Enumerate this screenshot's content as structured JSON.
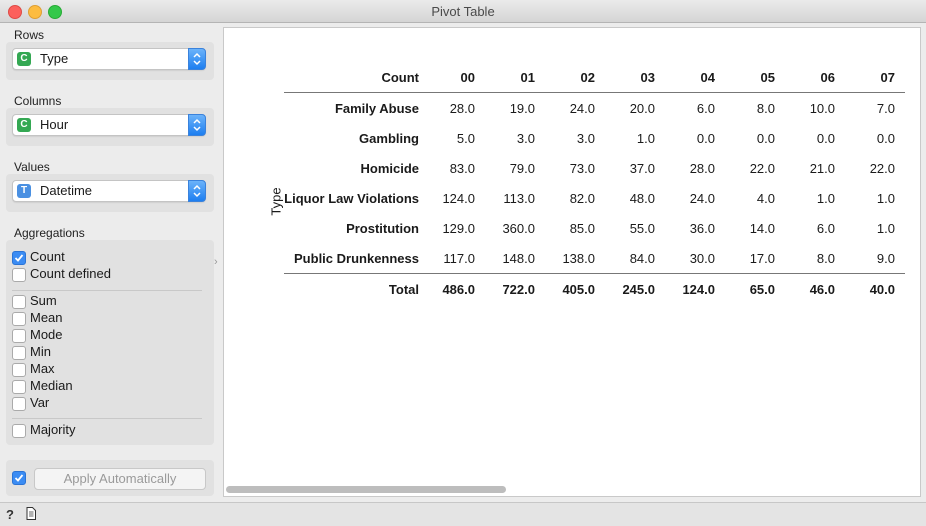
{
  "window": {
    "title": "Pivot Table"
  },
  "rows": {
    "label": "Rows",
    "value": "Type",
    "type_icon": "C"
  },
  "columns": {
    "label": "Columns",
    "value": "Hour",
    "type_icon": "C"
  },
  "values": {
    "label": "Values",
    "value": "Datetime",
    "type_icon": "T"
  },
  "aggregations": {
    "label": "Aggregations",
    "items": [
      {
        "label": "Count",
        "checked": true
      },
      {
        "label": "Count defined",
        "checked": false
      },
      {
        "label": "Sum",
        "checked": false
      },
      {
        "label": "Mean",
        "checked": false
      },
      {
        "label": "Mode",
        "checked": false
      },
      {
        "label": "Min",
        "checked": false
      },
      {
        "label": "Max",
        "checked": false
      },
      {
        "label": "Median",
        "checked": false
      },
      {
        "label": "Var",
        "checked": false
      },
      {
        "label": "Majority",
        "checked": false
      }
    ]
  },
  "apply": {
    "label": "Apply Automatically",
    "checked": true
  },
  "pivot": {
    "row_variable": "Type",
    "corner": "Count",
    "headers": [
      "00",
      "01",
      "02",
      "03",
      "04",
      "05",
      "06",
      "07"
    ],
    "rows": [
      {
        "label": "Family Abuse",
        "values": [
          "28.0",
          "19.0",
          "24.0",
          "20.0",
          "6.0",
          "8.0",
          "10.0",
          "7.0"
        ]
      },
      {
        "label": "Gambling",
        "values": [
          "5.0",
          "3.0",
          "3.0",
          "1.0",
          "0.0",
          "0.0",
          "0.0",
          "0.0"
        ]
      },
      {
        "label": "Homicide",
        "values": [
          "83.0",
          "79.0",
          "73.0",
          "37.0",
          "28.0",
          "22.0",
          "21.0",
          "22.0"
        ]
      },
      {
        "label": "Liquor Law Violations",
        "values": [
          "124.0",
          "113.0",
          "82.0",
          "48.0",
          "24.0",
          "4.0",
          "1.0",
          "1.0"
        ]
      },
      {
        "label": "Prostitution",
        "values": [
          "129.0",
          "360.0",
          "85.0",
          "55.0",
          "36.0",
          "14.0",
          "6.0",
          "1.0"
        ]
      },
      {
        "label": "Public Drunkenness",
        "values": [
          "117.0",
          "148.0",
          "138.0",
          "84.0",
          "30.0",
          "17.0",
          "8.0",
          "9.0"
        ]
      }
    ],
    "total": {
      "label": "Total",
      "values": [
        "486.0",
        "722.0",
        "405.0",
        "245.0",
        "124.0",
        "65.0",
        "46.0",
        "40.0"
      ]
    }
  },
  "statusbar": {
    "help_icon": "?",
    "report_icon": "report-icon"
  }
}
